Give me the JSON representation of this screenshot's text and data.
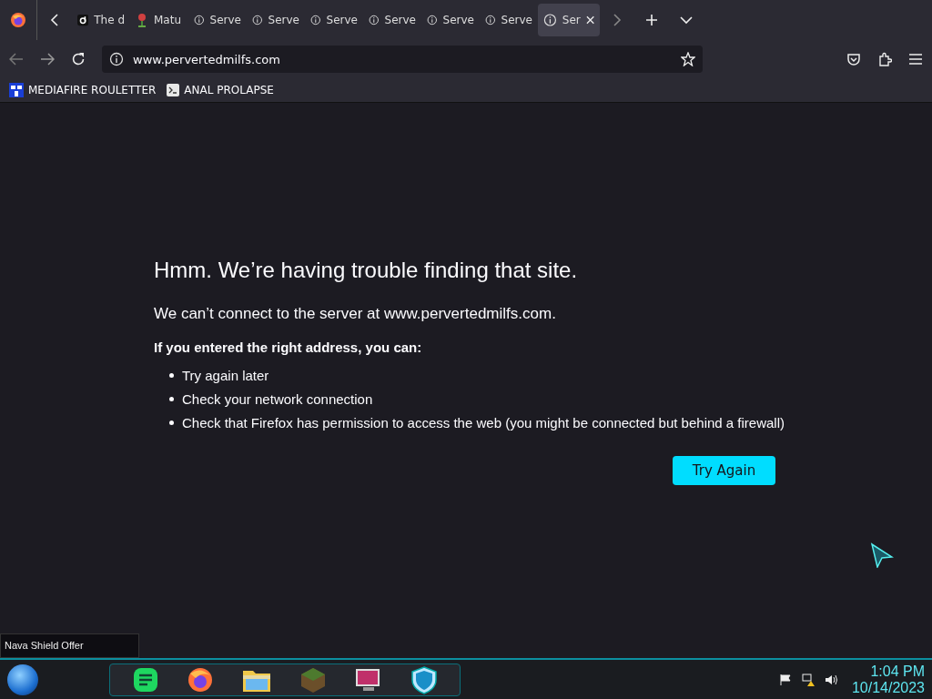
{
  "tabs": [
    {
      "kind": "logo",
      "title": "The d",
      "selected": false
    },
    {
      "kind": "pin",
      "title": "Matu",
      "selected": false
    },
    {
      "kind": "info",
      "title": "Serve",
      "selected": false
    },
    {
      "kind": "info",
      "title": "Serve",
      "selected": false
    },
    {
      "kind": "info",
      "title": "Serve",
      "selected": false
    },
    {
      "kind": "info",
      "title": "Serve",
      "selected": false
    },
    {
      "kind": "info",
      "title": "Serve",
      "selected": false
    },
    {
      "kind": "info",
      "title": "Serve",
      "selected": false
    },
    {
      "kind": "info",
      "title": "Ser",
      "selected": true
    }
  ],
  "address_bar": {
    "url": "www.pervertedmilfs.com"
  },
  "bookmarks": [
    {
      "kind": "mft",
      "label": "MEDIAFIRE ROULETTER"
    },
    {
      "kind": "term",
      "label": "ANAL PROLAPSE"
    }
  ],
  "error": {
    "title": "Hmm. We’re having trouble finding that site.",
    "message": "We can’t connect to the server at www.pervertedmilfs.com.",
    "subheading": "If you entered the right address, you can:",
    "suggestions": [
      "Try again later",
      "Check your network connection",
      "Check that Firefox has permission to access the web (you might be connected but behind a firewall)"
    ],
    "button": "Try Again"
  },
  "status_tooltip": "Nava Shield Offer",
  "taskbar": {
    "apps": [
      {
        "kind": "chat"
      },
      {
        "kind": "browser"
      },
      {
        "kind": "folder"
      },
      {
        "kind": "block"
      },
      {
        "kind": "monitor"
      },
      {
        "kind": "shield"
      }
    ],
    "time": "1:04 PM",
    "date": "10/14/2023"
  }
}
